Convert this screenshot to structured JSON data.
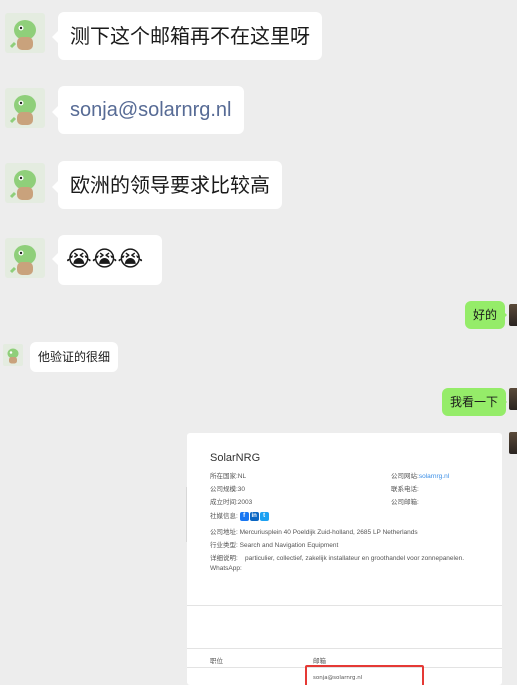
{
  "messages": {
    "m1": "测下这个邮箱再不在这里呀",
    "m2": "sonja@solarnrg.nl",
    "m3": "欧洲的领导要求比较高",
    "m4_emojis": [
      "😭",
      "😭",
      "😭"
    ],
    "m5_me": "好的",
    "m6": "他验证的很细",
    "m7_me": "我看一下"
  },
  "card": {
    "company": "SolarNRG",
    "country": "所在国家:NL",
    "size": "公司规模:30",
    "founded": "成立时间:2003",
    "website_label": "公司网站:",
    "website": "solarnrg.nl",
    "phone": "联系电话:",
    "mail": "公司邮箱:",
    "social": "社媒信息:",
    "social_icons": [
      "facebook",
      "linkedin",
      "twitter"
    ],
    "address": "公司地址: Mercuriusplein 40 Poeldijk Zuid-holland, 2685 LP Netherlands",
    "industry_label": "行业类型:",
    "industry": "Search and Navigation Equipment",
    "desc_label": "详细说明:",
    "desc": "particulier, collectief, zakelijk installateur en groothandel voor zonnepanelen.",
    "whatsapp": "WhatsApp:",
    "table_col1": "职位",
    "table_col2": "邮箱",
    "email_cell": "sonja@solarnrg.nl"
  },
  "colors": {
    "me_bubble": "#95ec69",
    "link": "#576b95",
    "highlight": "#e53935"
  }
}
